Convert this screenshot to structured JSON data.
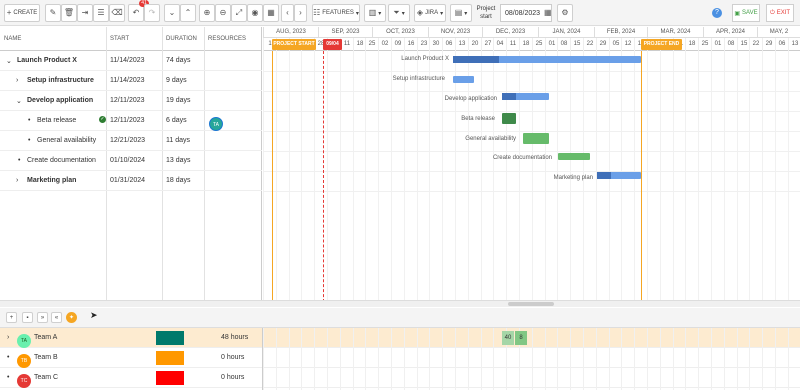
{
  "toolbar": {
    "create_label": "CREATE",
    "undo_count": "41",
    "features_label": "FEATURES",
    "jira_label": "JIRA",
    "project_start_label": "Project start",
    "project_start_date": "08/08/2023",
    "save_label": "SAVE",
    "exit_label": "EXIT"
  },
  "grid": {
    "columns": {
      "name": "NAME",
      "start": "START",
      "duration": "DURATION",
      "resources": "RESOURCES"
    },
    "rows": [
      {
        "name": "Launch Product X",
        "start": "11/14/2023",
        "duration": "74 days"
      },
      {
        "name": "Setup infrastructure",
        "start": "11/14/2023",
        "duration": "9 days"
      },
      {
        "name": "Develop application",
        "start": "12/11/2023",
        "duration": "19 days"
      },
      {
        "name": "Beta release",
        "start": "12/11/2023",
        "duration": "6 days",
        "resource": "TA"
      },
      {
        "name": "General availability",
        "start": "12/21/2023",
        "duration": "11 days"
      },
      {
        "name": "Create documentation",
        "start": "01/10/2024",
        "duration": "13 days"
      },
      {
        "name": "Marketing plan",
        "start": "01/31/2024",
        "duration": "18 days"
      }
    ]
  },
  "timeline": {
    "months": [
      "AUG, 2023",
      "SEP, 2023",
      "OCT, 2023",
      "NOV, 2023",
      "DEC, 2023",
      "JAN, 2024",
      "FEB, 2024",
      "MAR, 2024",
      "APR, 2024",
      "MAY, 2"
    ],
    "days": [
      "1",
      "7",
      "14",
      "21",
      "28",
      "04",
      "11",
      "18",
      "25",
      "02",
      "09",
      "16",
      "23",
      "30",
      "06",
      "13",
      "20",
      "27",
      "04",
      "11",
      "18",
      "25",
      "01",
      "08",
      "15",
      "22",
      "29",
      "05",
      "12",
      "19",
      "26",
      "04",
      "11",
      "18",
      "25",
      "01",
      "08",
      "15",
      "22",
      "29",
      "06",
      "13"
    ],
    "project_start_marker": "PROJECT START",
    "today_marker": "09/04",
    "project_end_marker": "PROJECT END",
    "bar_labels": [
      "Launch Product X",
      "Setup infrastructure",
      "Develop application",
      "Beta release",
      "General availability",
      "Create documentation",
      "Marketing plan"
    ]
  },
  "resources": {
    "rows": [
      {
        "initials": "TA",
        "name": "Team A",
        "color": "#00796b",
        "hours": "48 hours",
        "cells": [
          "40",
          "8"
        ]
      },
      {
        "initials": "TB",
        "name": "Team B",
        "color": "#ff9800",
        "hours": "0 hours"
      },
      {
        "initials": "TC",
        "name": "Team C",
        "color": "#ff0000",
        "hours": "0 hours"
      }
    ]
  },
  "colors": {
    "accent": "#f5a623",
    "today": "#e53935",
    "parent_bar": "#6a9fe8",
    "task_bar": "#66bb6a",
    "selected_row": "#fdebd0"
  }
}
